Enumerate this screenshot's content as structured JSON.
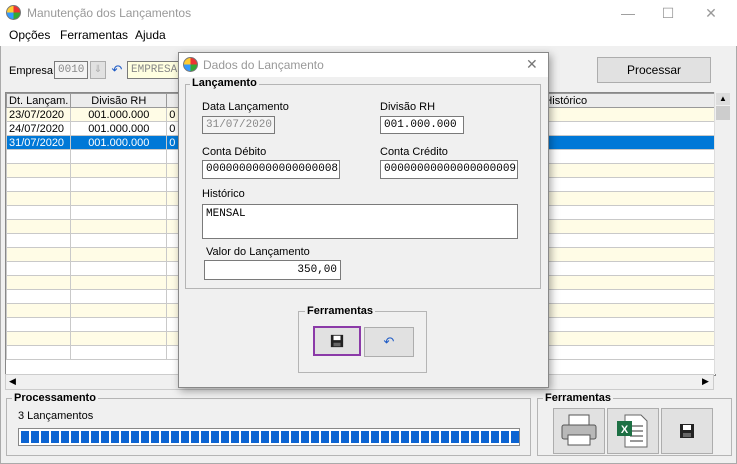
{
  "window": {
    "title": "Manutenção dos Lançamentos",
    "controls": [
      "—",
      "☐",
      "✕"
    ]
  },
  "menu": [
    "Opções",
    "Ferramentas",
    "Ajuda"
  ],
  "toolbar": {
    "empresa_label": "Empresa:",
    "empresa_code": "0010",
    "empresa_name": "EMPRESA",
    "processar_label": "Processar"
  },
  "grid": {
    "headers": [
      "Dt. Lançam.",
      "Divisão RH",
      "",
      "Histórico"
    ],
    "rows": [
      {
        "date": "23/07/2020",
        "divisao": "001.000.000",
        "c3": "0",
        "selected": false
      },
      {
        "date": "24/07/2020",
        "divisao": "001.000.000",
        "c3": "0",
        "selected": false
      },
      {
        "date": "31/07/2020",
        "divisao": "001.000.000",
        "c3": "0",
        "selected": true
      }
    ],
    "row_colors": {
      "odd": "#fffce6",
      "even": "#ffffff",
      "selected": "#0078d7"
    }
  },
  "processamento": {
    "title": "Processamento",
    "status": "3 Lançamentos",
    "progress": 1.0,
    "bar_color": "#0c64d2"
  },
  "ferramentas_main": {
    "title": "Ferramentas",
    "icons": [
      "printer-icon",
      "excel-icon",
      "save-icon"
    ]
  },
  "dialog": {
    "title": "Dados do Lançamento",
    "group_title": "Lançamento",
    "data_label": "Data Lançamento",
    "data_value": "31/07/2020",
    "divisao_label": "Divisão RH",
    "divisao_value": "001.000.000",
    "debito_label": "Conta Débito",
    "debito_value": "00000000000000000008",
    "credito_label": "Conta Crédito",
    "credito_value": "00000000000000000009",
    "historico_label": "Histórico",
    "historico_value": "MENSAL",
    "valor_label": "Valor do Lançamento",
    "valor_value": "350,00",
    "tools_title": "Ferramentas",
    "focus_color": "#8b3aa8"
  }
}
